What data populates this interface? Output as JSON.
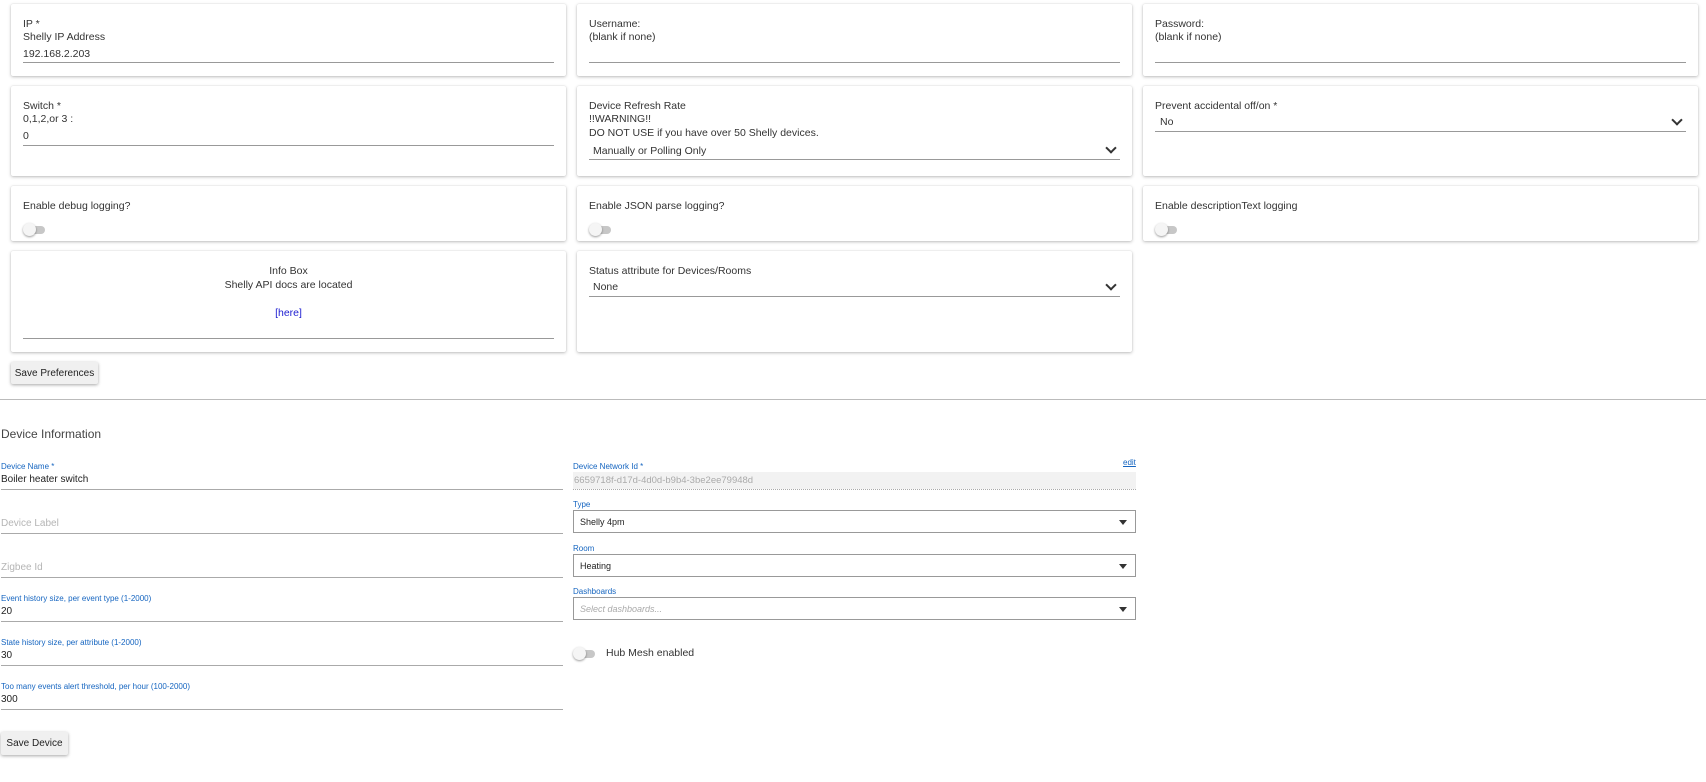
{
  "preferences": {
    "ip": {
      "label": "IP *",
      "sublabel": "Shelly IP Address",
      "value": "192.168.2.203"
    },
    "username": {
      "label": "Username:",
      "sublabel": "(blank if none)",
      "value": ""
    },
    "password": {
      "label": "Password:",
      "sublabel": "(blank if none)",
      "value": ""
    },
    "switch": {
      "label": "Switch *",
      "sublabel": "0,1,2,or 3 :",
      "value": "0"
    },
    "refresh_rate": {
      "label": "Device Refresh Rate",
      "warning": "!!WARNING!!",
      "note": "DO NOT USE if you have over 50 Shelly devices.",
      "selected": "Manually or Polling Only"
    },
    "prevent_accidental": {
      "label": "Prevent accidental off/on *",
      "selected": "No"
    },
    "debug_logging": {
      "label": "Enable debug logging?",
      "enabled": false
    },
    "json_logging": {
      "label": "Enable JSON parse logging?",
      "enabled": false
    },
    "desc_logging": {
      "label": "Enable descriptionText logging",
      "enabled": false
    },
    "info_box": {
      "title": "Info Box",
      "text": "Shelly API docs are located",
      "link": "[here]"
    },
    "status_attribute": {
      "label": "Status attribute for Devices/Rooms",
      "selected": "None"
    },
    "save_label": "Save Preferences"
  },
  "device_info": {
    "title": "Device Information",
    "device_name": {
      "label": "Device Name *",
      "value": "Boiler heater switch"
    },
    "device_label": {
      "placeholder": "Device Label"
    },
    "zigbee_id": {
      "placeholder": "Zigbee Id"
    },
    "event_history": {
      "label": "Event history size, per event type (1-2000)",
      "value": "20"
    },
    "state_history": {
      "label": "State history size, per attribute (1-2000)",
      "value": "30"
    },
    "too_many_events": {
      "label": "Too many events alert threshold, per hour (100-2000)",
      "value": "300"
    },
    "network_id": {
      "label": "Device Network Id *",
      "value": "6659718f-d17d-4d0d-b9b4-3be2ee79948d",
      "edit": "edit"
    },
    "type": {
      "label": "Type *",
      "selected": "Shelly 4pm"
    },
    "room": {
      "label": "Room",
      "selected": "Heating"
    },
    "dashboards": {
      "label": "Dashboards",
      "placeholder": "Select dashboards..."
    },
    "hub_mesh": {
      "label": "Hub Mesh enabled",
      "enabled": false
    },
    "save_label": "Save Device"
  }
}
